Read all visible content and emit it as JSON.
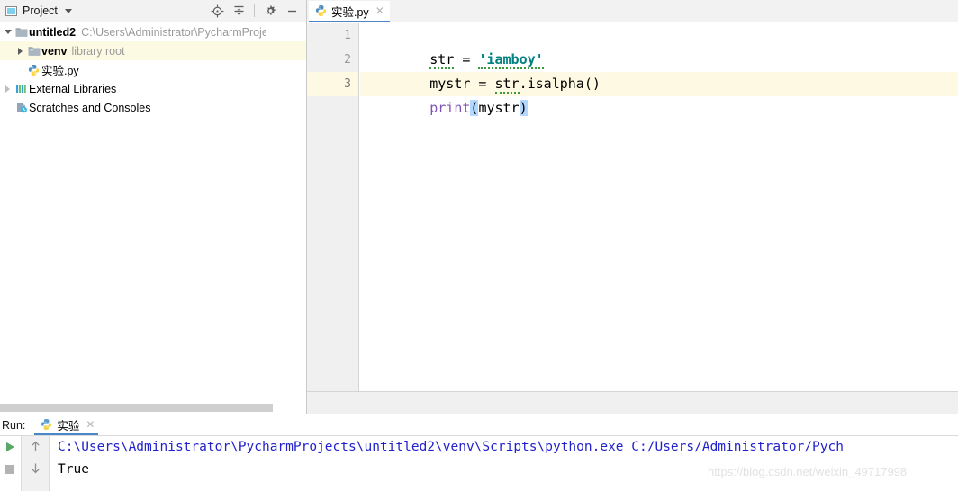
{
  "project_panel": {
    "header": {
      "title": "Project",
      "dropdown_caret_icon": "chevron-down-icon",
      "buttons": [
        {
          "name": "locate-icon",
          "tooltip": "Select Opened File"
        },
        {
          "name": "collapse-all-icon",
          "tooltip": "Collapse All"
        },
        {
          "name": "gear-icon",
          "tooltip": "Settings"
        },
        {
          "name": "hide-icon",
          "tooltip": "Hide"
        }
      ]
    },
    "tree": [
      {
        "label": "untitled2",
        "secondary": "C:\\Users\\Administrator\\PycharmProjects\\un",
        "icon": "folder-module-icon",
        "arrow": "expanded",
        "indent": 0,
        "bold": true,
        "highlight": false
      },
      {
        "label": "venv",
        "secondary": "library root",
        "icon": "folder-venv-icon",
        "arrow": "collapsed",
        "indent": 1,
        "bold": true,
        "highlight": true
      },
      {
        "label": "实验.py",
        "secondary": "",
        "icon": "python-file-icon",
        "arrow": "none",
        "indent": 1,
        "bold": false,
        "highlight": false
      },
      {
        "label": "External Libraries",
        "secondary": "",
        "icon": "libraries-icon",
        "arrow": "collapsed",
        "indent": 0,
        "bold": false,
        "highlight": false
      },
      {
        "label": "Scratches and Consoles",
        "secondary": "",
        "icon": "scratches-icon",
        "arrow": "none",
        "indent": 0,
        "bold": false,
        "highlight": false
      }
    ]
  },
  "editor": {
    "tab": {
      "title": "实验.py",
      "icon": "python-file-icon",
      "close_icon": "close-icon",
      "active": true
    },
    "active_line": 3,
    "lines": [
      {
        "number": "1",
        "tokens": [
          {
            "text": "str",
            "type": "default",
            "squiggly": true
          },
          {
            "text": " = ",
            "type": "default",
            "squiggly": false
          },
          {
            "text": "'iamboy'",
            "type": "string",
            "squiggly": true
          }
        ]
      },
      {
        "number": "2",
        "tokens": [
          {
            "text": "mystr",
            "type": "default",
            "squiggly": false
          },
          {
            "text": " = ",
            "type": "default",
            "squiggly": false
          },
          {
            "text": "str",
            "type": "default",
            "squiggly": true
          },
          {
            "text": ".isalpha()",
            "type": "default",
            "squiggly": false
          }
        ]
      },
      {
        "number": "3",
        "tokens": [
          {
            "text": "print",
            "type": "keyword",
            "squiggly": false
          },
          {
            "text": "(",
            "type": "bracket",
            "squiggly": false
          },
          {
            "text": "mystr",
            "type": "default",
            "squiggly": false
          },
          {
            "text": ")",
            "type": "bracket",
            "squiggly": false
          }
        ]
      }
    ]
  },
  "run_panel": {
    "label": "Run:",
    "tab": {
      "title": "实验",
      "icon": "python-icon",
      "close_icon": "close-icon"
    },
    "left_buttons": [
      {
        "name": "rerun-icon",
        "label": "Rerun"
      },
      {
        "name": "stop-icon",
        "label": "Stop"
      }
    ],
    "nav_buttons": [
      {
        "name": "arrow-up-icon",
        "label": "Previous Occurrence"
      },
      {
        "name": "arrow-down-icon",
        "label": "Next Occurrence"
      }
    ],
    "console": [
      {
        "text": "C:\\Users\\Administrator\\PycharmProjects\\untitled2\\venv\\Scripts\\python.exe C:/Users/Administrator/Pych",
        "type": "command"
      },
      {
        "text": "True",
        "type": "output"
      }
    ]
  },
  "watermark": {
    "text": "https://blog.csdn.net/weixin_49717998"
  },
  "colors": {
    "accent_blue": "#4a86c8",
    "highlight_yellow": "#fdf9e3",
    "string_green": "#008080",
    "keyword_purple": "#7f55b3",
    "console_blue": "#2222cc",
    "panel_gray": "#f0f2f2"
  }
}
